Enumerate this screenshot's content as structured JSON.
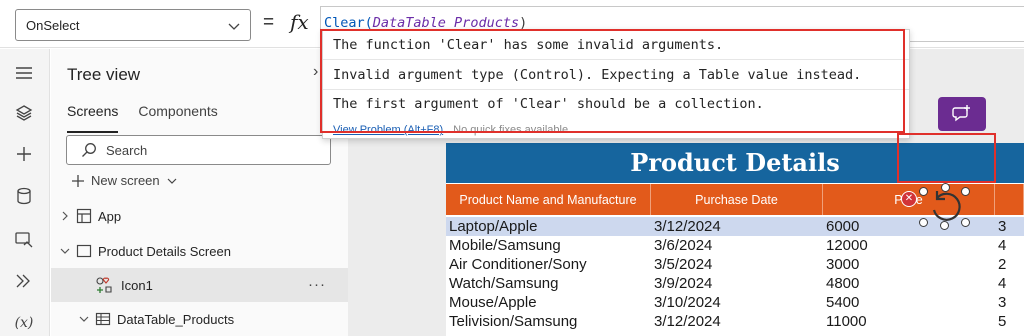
{
  "formula_bar": {
    "property": "OnSelect",
    "equals": "=",
    "fx": "fx",
    "formula_fn": "Clear(",
    "formula_arg": "DataTable_Products",
    "formula_close": ")"
  },
  "tooltip": {
    "line1": "The function 'Clear' has some invalid arguments.",
    "line2": "Invalid argument type (Control). Expecting a Table value instead.",
    "line3": "The first argument of 'Clear' should be a collection.",
    "link": "View Problem (Alt+F8)",
    "no_fix": "No quick fixes available"
  },
  "tree_view": {
    "title": "Tree view",
    "close": "›",
    "tabs": [
      {
        "label": "Screens"
      },
      {
        "label": "Components"
      }
    ],
    "search_placeholder": "Search",
    "new_screen": "New screen",
    "items": [
      {
        "label": "App"
      },
      {
        "label": "Product Details Screen"
      },
      {
        "label": "Icon1",
        "menu": "···"
      },
      {
        "label": "DataTable_Products"
      }
    ]
  },
  "canvas": {
    "banner_title": "Product Details",
    "columns": [
      "Product Name and Manufacture",
      "Purchase Date",
      "Price",
      ""
    ],
    "rows": [
      [
        "Laptop/Apple",
        "3/12/2024",
        "6000",
        "3"
      ],
      [
        "Mobile/Samsung",
        "3/6/2024",
        "12000",
        "4"
      ],
      [
        "Air Conditioner/Sony",
        "3/5/2024",
        "3000",
        "2"
      ],
      [
        "Watch/Samsung",
        "3/9/2024",
        "4800",
        "4"
      ],
      [
        "Mouse/Apple",
        "3/10/2024",
        "5400",
        "3"
      ],
      [
        "Telivision/Samsung",
        "3/12/2024",
        "11000",
        "5"
      ]
    ]
  },
  "colors": {
    "banner": "#16659e",
    "table_header": "#e25a1b",
    "selected_row": "#cdd8ee",
    "highlight_box": "#e0302b",
    "comment_button": "#6b2c91"
  },
  "icons": [
    "chevron-down-icon",
    "hamburger-icon",
    "layers-icon",
    "plus-icon",
    "database-icon",
    "media-icon",
    "advanced-tools-icon",
    "variables-icon",
    "search-icon",
    "screen-icon",
    "data-table-icon",
    "reset-icon",
    "comment-add-icon",
    "error-icon"
  ]
}
